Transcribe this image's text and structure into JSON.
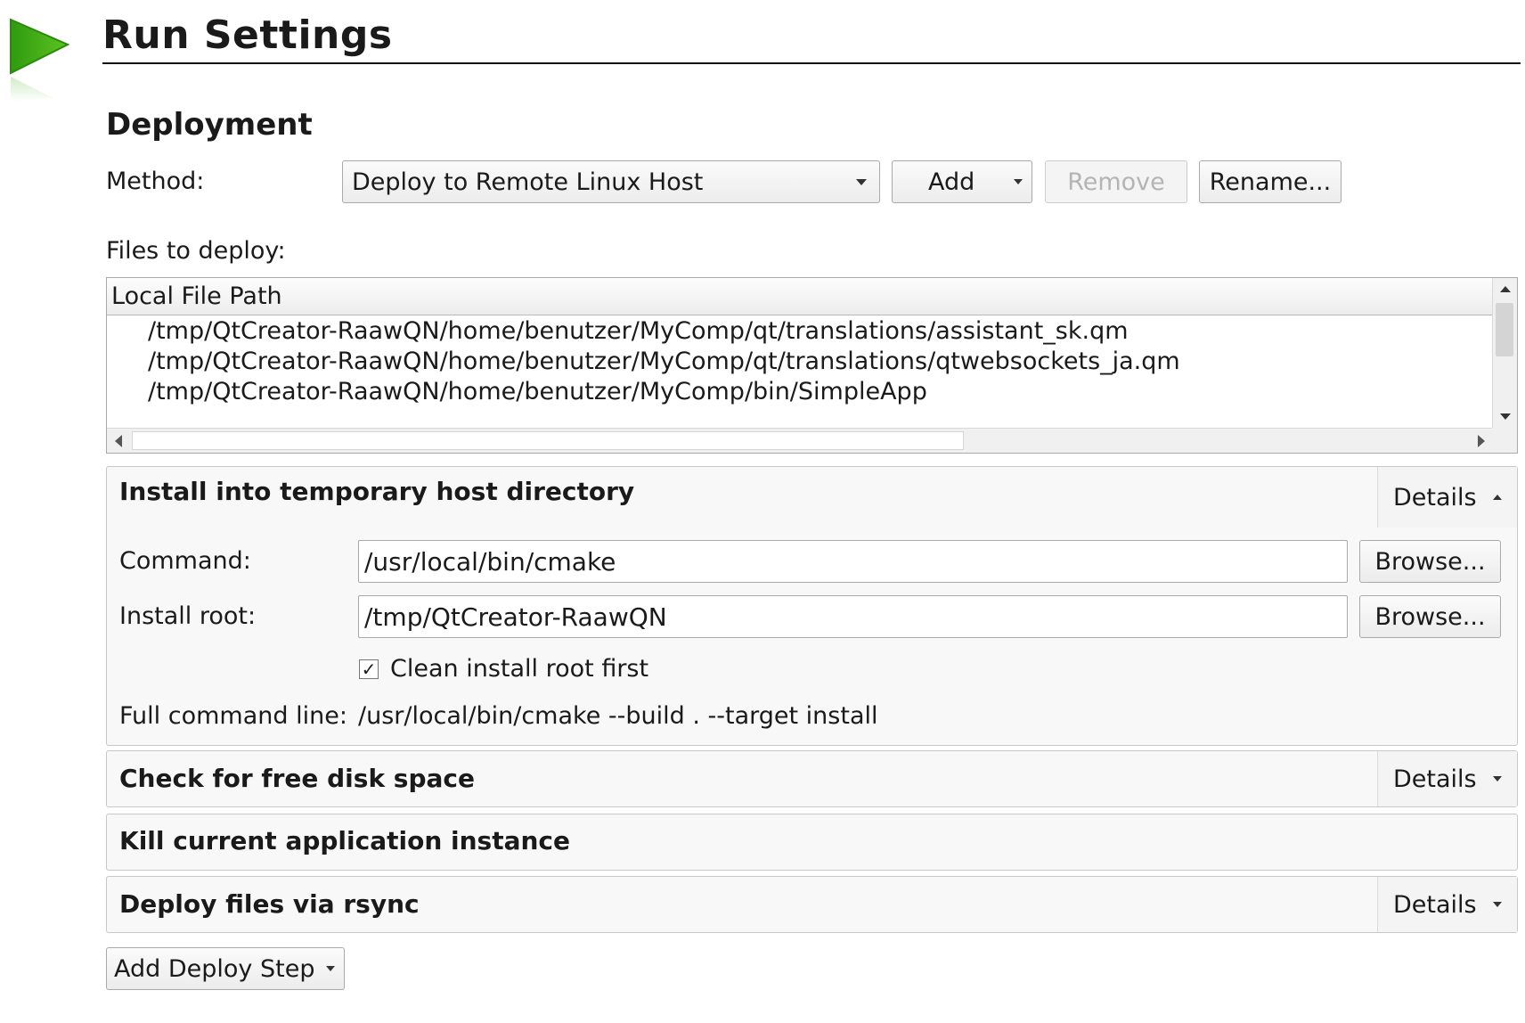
{
  "header": {
    "title": "Run Settings",
    "accent_color": "#3aa514"
  },
  "deployment": {
    "section_title": "Deployment",
    "method_label": "Method:",
    "method_value": "Deploy to Remote Linux Host",
    "add_label": "Add",
    "remove_label": "Remove",
    "rename_label": "Rename...",
    "files_label": "Files to deploy:",
    "files_table": {
      "column_header": "Local File Path",
      "rows": [
        "/tmp/QtCreator-RaawQN/home/benutzer/MyComp/qt/translations/assistant_sk.qm",
        "/tmp/QtCreator-RaawQN/home/benutzer/MyComp/qt/translations/qtwebsockets_ja.qm",
        "/tmp/QtCreator-RaawQN/home/benutzer/MyComp/bin/SimpleApp"
      ]
    }
  },
  "steps": {
    "install": {
      "title": "Install into temporary host directory",
      "details_label": "Details",
      "command_label": "Command:",
      "command_value": "/usr/local/bin/cmake",
      "install_root_label": "Install root:",
      "install_root_value": "/tmp/QtCreator-RaawQN",
      "browse_label": "Browse...",
      "clean_label": "Clean install root first",
      "clean_checked": true,
      "full_cmd_label": "Full command line:",
      "full_cmd_value": "/usr/local/bin/cmake --build . --target install"
    },
    "disk": {
      "title": "Check for free disk space",
      "details_label": "Details"
    },
    "kill": {
      "title": "Kill current application instance"
    },
    "rsync": {
      "title": "Deploy files via rsync",
      "details_label": "Details"
    }
  },
  "add_step_label": "Add Deploy Step"
}
